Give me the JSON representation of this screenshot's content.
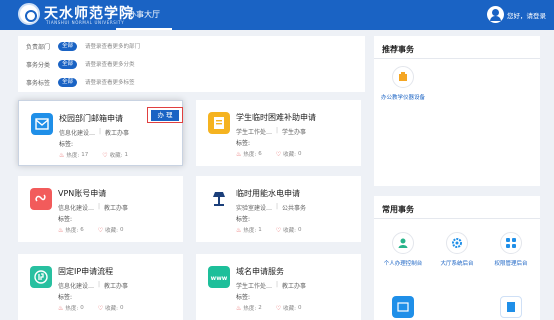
{
  "header": {
    "logo_cn": "天水师范学院",
    "logo_en": "TIANSHUI NORMAL UNIVERSITY",
    "nav_tab": "办事大厅",
    "login": "您好，请登录"
  },
  "filters": [
    {
      "label": "负责部门",
      "chip": "全部",
      "hint": "请登录查看更多的部门"
    },
    {
      "label": "事务分类",
      "chip": "全部",
      "hint": "请登录查看更多分类"
    },
    {
      "label": "事务标签",
      "chip": "全部",
      "hint": "请登录查看更多标签"
    }
  ],
  "cards": [
    {
      "title": "校园部门邮箱申请",
      "dept": "信息化建设…",
      "category": "教工办事",
      "tag_label": "标签:",
      "heat_label": "热度:",
      "heat": "17",
      "fav_label": "收藏:",
      "fav": "1",
      "button": "办 理",
      "icon": "mail-icon",
      "color": "#1f8fe8"
    },
    {
      "title": "学生临时困难补助申请",
      "dept": "学生工作处…",
      "category": "学生办事",
      "tag_label": "标签:",
      "heat_label": "热度:",
      "heat": "6",
      "fav_label": "收藏:",
      "fav": "0",
      "icon": "document-icon",
      "color": "#f5b320"
    },
    {
      "title": "VPN账号申请",
      "dept": "信息化建设…",
      "category": "教工办事",
      "tag_label": "标签:",
      "heat_label": "热度:",
      "heat": "6",
      "fav_label": "收藏:",
      "fav": "0",
      "icon": "link-icon",
      "color": "#f25b5b"
    },
    {
      "title": "临时用能水电申请",
      "dept": "实验室建设…",
      "category": "公共事务",
      "tag_label": "标签:",
      "heat_label": "热度:",
      "heat": "1",
      "fav_label": "收藏:",
      "fav": "0",
      "icon": "lamp-icon",
      "color": "#1b3f7a"
    },
    {
      "title": "固定IP申请流程",
      "dept": "信息化建设…",
      "category": "教工办事",
      "tag_label": "标签:",
      "heat_label": "热度:",
      "heat": "0",
      "fav_label": "收藏:",
      "fav": "0",
      "icon": "ip-icon",
      "color": "#28c0a0"
    },
    {
      "title": "域名申请服务",
      "dept": "学生工作处…",
      "category": "教工办事",
      "tag_label": "标签:",
      "heat_label": "热度:",
      "heat": "2",
      "fav_label": "收藏:",
      "fav": "0",
      "icon": "www-icon",
      "color": "#1dbf9a"
    }
  ],
  "recommended": {
    "title": "推荐事务",
    "items": [
      {
        "label": "办公教学仪器设备"
      }
    ]
  },
  "common": {
    "title": "常用事务",
    "items": [
      {
        "label": "个人办理控制台"
      },
      {
        "label": "大厅系统后台"
      },
      {
        "label": "权限管理后台"
      },
      {
        "label": ""
      },
      {
        "label": ""
      }
    ]
  }
}
